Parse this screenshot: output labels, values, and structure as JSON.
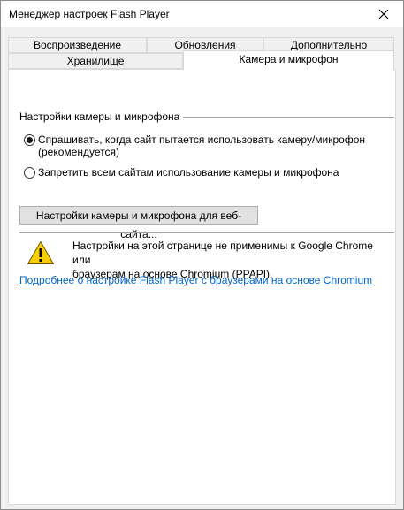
{
  "window": {
    "title": "Менеджер настроек Flash Player",
    "close_icon": "close-icon"
  },
  "tabs": {
    "row1": [
      {
        "label": "Воспроизведение",
        "active": false
      },
      {
        "label": "Обновления",
        "active": false
      },
      {
        "label": "Дополнительно",
        "active": false
      }
    ],
    "row2": [
      {
        "label": "Хранилище",
        "active": false
      },
      {
        "label": "Камера и микрофон",
        "active": true
      }
    ]
  },
  "camera_settings": {
    "group_label": "Настройки камеры и микрофона",
    "options": [
      {
        "label_line1": "Спрашивать, когда сайт пытается использовать камеру/микрофон",
        "label_line2": "(рекомендуется)",
        "selected": true
      },
      {
        "label_line1": "Запретить всем сайтам использование камеры и микрофона",
        "selected": false
      }
    ],
    "site_settings_button": "Настройки камеры и микрофона для веб-сайта..."
  },
  "notice": {
    "icon": "warning-icon",
    "line1": "Настройки на этой странице не применимы к Google Chrome или",
    "line2": "браузерам на основе Chromium (PPAPI).",
    "link_text": "Подробнее о настройке Flash Player с браузерами на основе Chromium"
  },
  "colors": {
    "link": "#0066cc",
    "warning_fill": "#f9cf00"
  }
}
